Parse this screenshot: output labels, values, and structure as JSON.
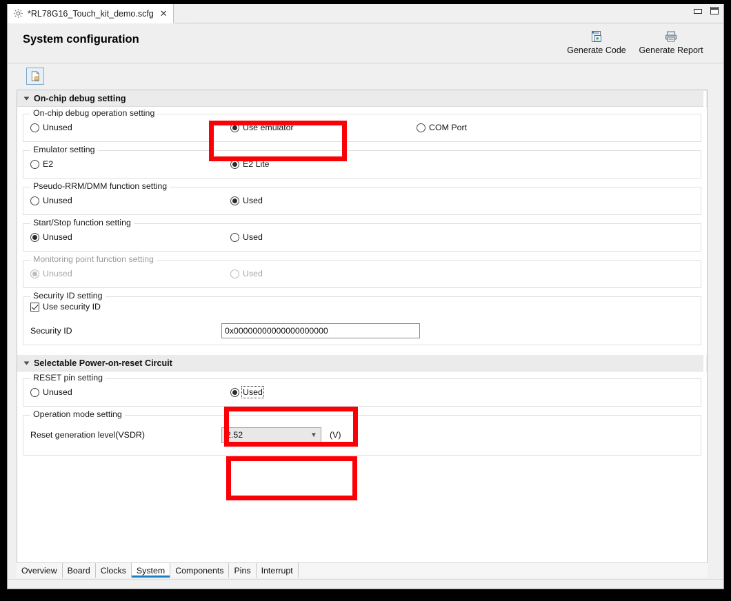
{
  "window": {
    "tab_title": "*RL78G16_Touch_kit_demo.scfg",
    "tab_icon": "gear-icon",
    "close_icon": "close-icon",
    "minimize_icon": "minimize-icon",
    "maximize_icon": "maximize-icon"
  },
  "header": {
    "title": "System configuration",
    "actions": [
      {
        "label": "Generate Code",
        "icon": "generate-code-icon"
      },
      {
        "label": "Generate Report",
        "icon": "generate-report-icon"
      }
    ]
  },
  "toolbar": {
    "buttons": [
      {
        "icon": "new-document-icon",
        "tooltip": ""
      }
    ]
  },
  "sections": [
    {
      "id": "on-chip-debug-setting",
      "title": "On-chip debug setting",
      "expanded": true,
      "groups": [
        {
          "id": "on-chip-debug-operation-setting",
          "legend": "On-chip debug operation setting",
          "enabled": true,
          "type": "radio",
          "options": [
            {
              "label": "Unused",
              "checked": false
            },
            {
              "label": "Use emulator",
              "checked": true
            },
            {
              "label": "COM Port",
              "checked": false
            }
          ]
        },
        {
          "id": "emulator-setting",
          "legend": "Emulator setting",
          "enabled": true,
          "type": "radio",
          "options": [
            {
              "label": "E2",
              "checked": false
            },
            {
              "label": "E2 Lite",
              "checked": true
            }
          ]
        },
        {
          "id": "pseudo-rrm-dmm-function-setting",
          "legend": "Pseudo-RRM/DMM function setting",
          "enabled": true,
          "type": "radio",
          "options": [
            {
              "label": "Unused",
              "checked": false
            },
            {
              "label": "Used",
              "checked": true
            }
          ]
        },
        {
          "id": "start-stop-function-setting",
          "legend": "Start/Stop function setting",
          "enabled": true,
          "type": "radio",
          "options": [
            {
              "label": "Unused",
              "checked": true
            },
            {
              "label": "Used",
              "checked": false
            }
          ]
        },
        {
          "id": "monitoring-point-function-setting",
          "legend": "Monitoring point function setting",
          "enabled": false,
          "type": "radio",
          "options": [
            {
              "label": "Unused",
              "checked": true
            },
            {
              "label": "Used",
              "checked": false
            }
          ]
        },
        {
          "id": "security-id-setting",
          "legend": "Security ID setting",
          "enabled": true,
          "type": "security",
          "checkbox": {
            "label": "Use security ID",
            "checked": true
          },
          "field": {
            "label": "Security ID",
            "value": "0x00000000000000000000"
          }
        }
      ]
    },
    {
      "id": "selectable-power-on-reset-circuit",
      "title": "Selectable Power-on-reset Circuit",
      "expanded": true,
      "groups": [
        {
          "id": "reset-pin-setting",
          "legend": "RESET pin setting",
          "enabled": true,
          "type": "radio",
          "options": [
            {
              "label": "Unused",
              "checked": false
            },
            {
              "label": "Used",
              "checked": true,
              "focused": true
            }
          ]
        },
        {
          "id": "operation-mode-setting",
          "legend": "Operation mode setting",
          "enabled": true,
          "type": "combo",
          "field": {
            "label": "Reset generation level(VSDR)",
            "value": "2.52",
            "unit": "(V)"
          }
        }
      ]
    }
  ],
  "bottom_tabs": {
    "items": [
      {
        "label": "Overview",
        "active": false
      },
      {
        "label": "Board",
        "active": false
      },
      {
        "label": "Clocks",
        "active": false
      },
      {
        "label": "System",
        "active": true
      },
      {
        "label": "Components",
        "active": false
      },
      {
        "label": "Pins",
        "active": false
      },
      {
        "label": "Interrupt",
        "active": false
      }
    ]
  },
  "annotations": {
    "accent_color": "#fb0007",
    "boxes": [
      {
        "name": "use-emulator-highlight"
      },
      {
        "name": "reset-pin-used-highlight"
      },
      {
        "name": "reset-generation-level-highlight"
      }
    ]
  }
}
